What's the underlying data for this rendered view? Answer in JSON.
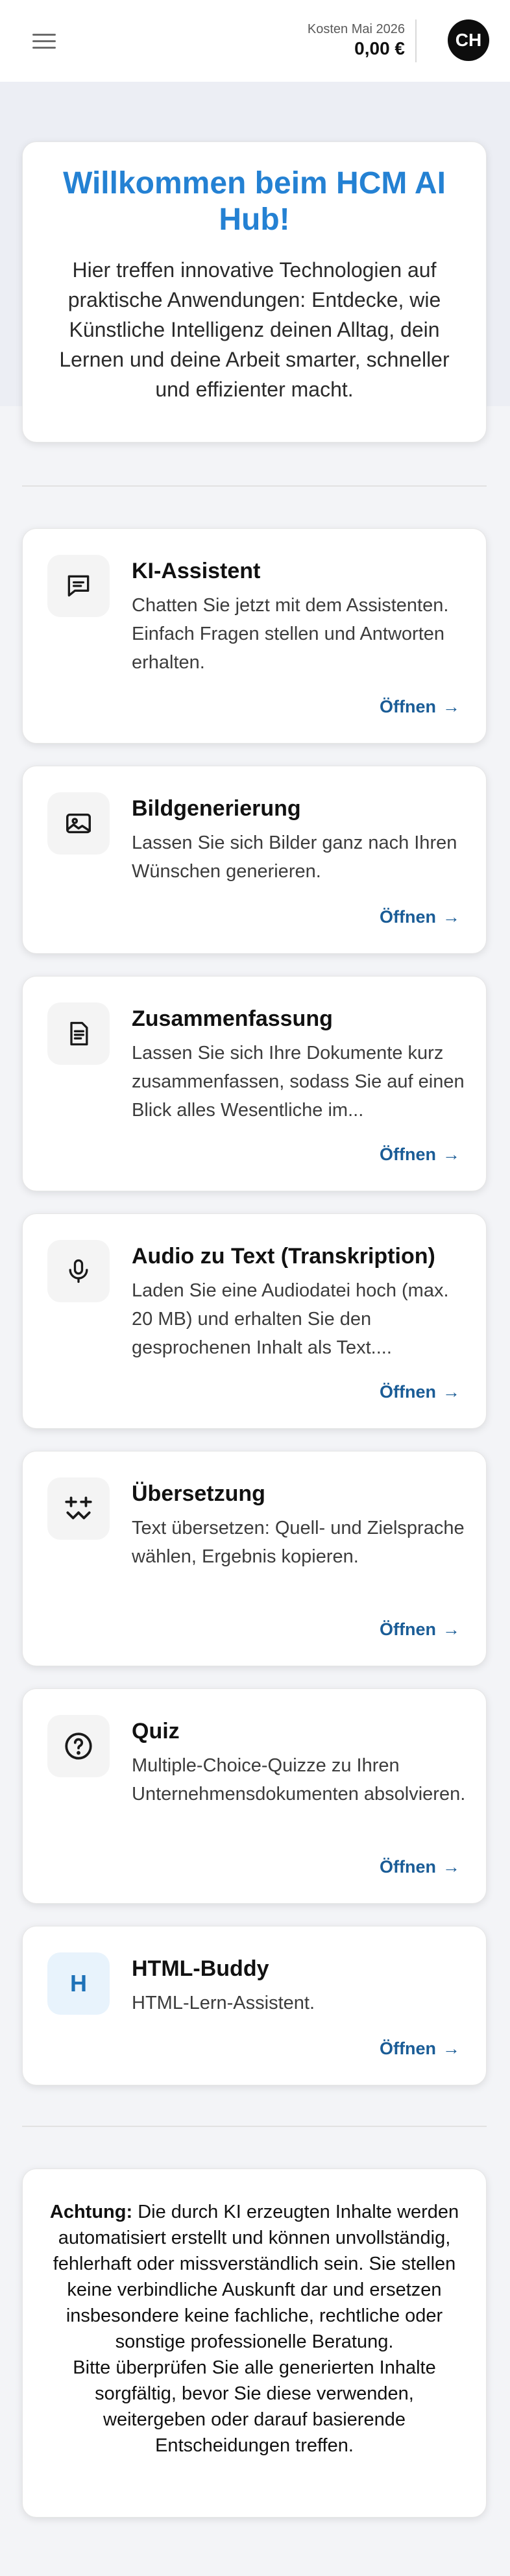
{
  "header": {
    "menu_icon": "hamburger-menu-icon",
    "cost_label": "Kosten Mai 2026",
    "cost_value": "0,00 €",
    "avatar_initials": "CH"
  },
  "welcome": {
    "title": "Willkommen beim HCM AI Hub!",
    "text": "Hier treffen innovative Technologien auf praktische Anwendungen: Entdecke, wie Künstliche Intelligenz deinen Alltag, dein Lernen und deine Arbeit smarter, schneller und effizienter macht."
  },
  "tools": [
    {
      "icon": "chat-bubble-icon",
      "title": "KI-Assistent",
      "description": "Chatten Sie jetzt mit dem Assistenten. Einfach Fragen stellen und Antworten erhalten.",
      "action": "Öffnen"
    },
    {
      "icon": "image-icon",
      "title": "Bildgenerierung",
      "description": "Lassen Sie sich Bilder ganz nach Ihren Wünschen generieren.",
      "action": "Öffnen"
    },
    {
      "icon": "document-icon",
      "title": "Zusammenfassung",
      "description": "Lassen Sie sich Ihre Dokumente kurz zusammenfassen, sodass Sie auf einen Blick alles Wesentliche im...",
      "action": "Öffnen"
    },
    {
      "icon": "microphone-icon",
      "title": "Audio zu Text (Transkription)",
      "description": "Laden Sie eine Audiodatei hoch (max. 20 MB) und erhalten Sie den gesprochenen Inhalt als Text....",
      "action": "Öffnen"
    },
    {
      "icon": "translate-arrows-icon",
      "title": "Übersetzung",
      "description": "Text übersetzen: Quell- und Zielsprache wählen, Ergebnis kopieren.",
      "action": "Öffnen"
    },
    {
      "icon": "question-circle-icon",
      "title": "Quiz",
      "description": "Multiple-Choice-Quizze zu Ihren Unternehmensdokumenten absolvieren.",
      "action": "Öffnen"
    },
    {
      "icon_letter": "H",
      "title": "HTML-Buddy",
      "description": "HTML-Lern-Assistent.",
      "action": "Öffnen"
    }
  ],
  "disclaimer": {
    "label": "Achtung:",
    "text1": " Die durch KI erzeugten Inhalte werden automatisiert erstellt und können unvollständig, fehlerhaft oder missverständlich sein. Sie stellen keine verbindliche Auskunft dar und ersetzen insbesondere keine fachliche, rechtliche oder sonstige professionelle Beratung.",
    "text2": "Bitte überprüfen Sie alle generierten Inhalte sorgfältig, bevor Sie diese verwenden, weitergeben oder darauf basierende Entscheidungen treffen."
  }
}
